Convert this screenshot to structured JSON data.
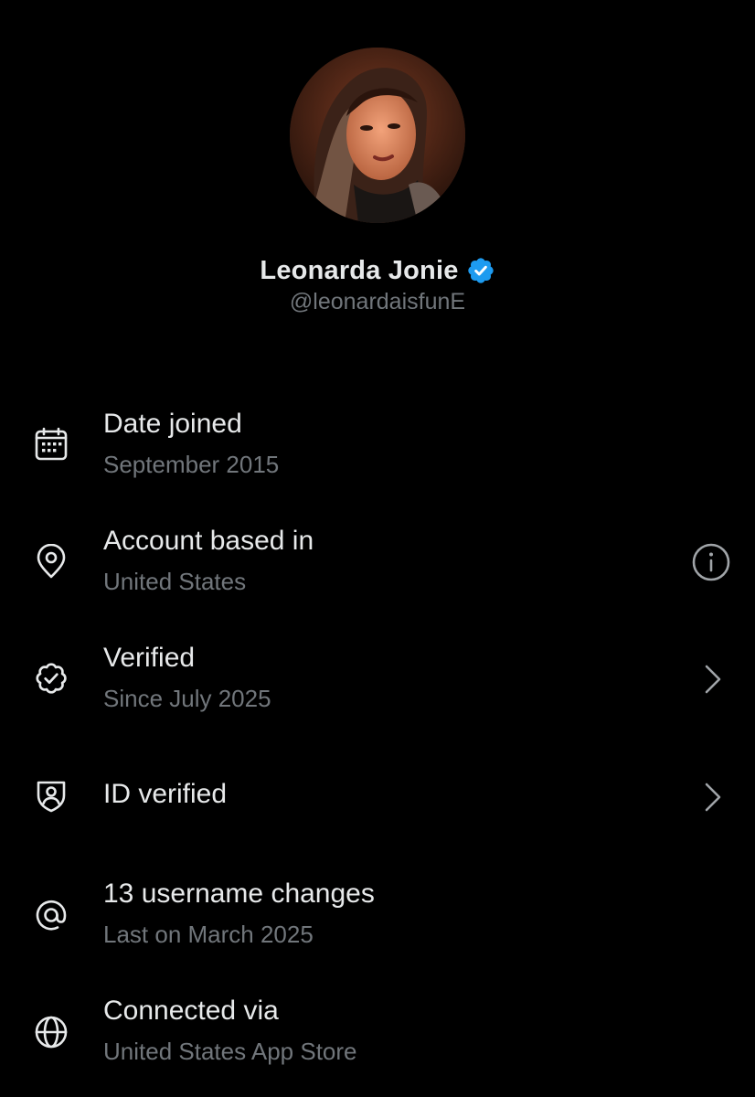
{
  "profile": {
    "display_name": "Leonarda Jonie",
    "handle": "@leonardaisfunE",
    "verified_badge_color": "#1d9bf0"
  },
  "rows": [
    {
      "icon": "calendar-icon",
      "title": "Date joined",
      "subtitle": "September 2015",
      "action": ""
    },
    {
      "icon": "location-pin-icon",
      "title": "Account based in",
      "subtitle": "United States",
      "action": "info-icon"
    },
    {
      "icon": "verified-badge-icon",
      "title": "Verified",
      "subtitle": "Since July 2025",
      "action": "chevron-right-icon"
    },
    {
      "icon": "shield-person-icon",
      "title": "ID verified",
      "subtitle": "",
      "action": "chevron-right-icon"
    },
    {
      "icon": "at-sign-icon",
      "title": "13 username changes",
      "subtitle": "Last on March 2025",
      "action": ""
    },
    {
      "icon": "globe-icon",
      "title": "Connected via",
      "subtitle": "United States App Store",
      "action": ""
    }
  ],
  "colors": {
    "background": "#000000",
    "primary_text": "#e7e9ea",
    "secondary_text": "#71767b"
  }
}
